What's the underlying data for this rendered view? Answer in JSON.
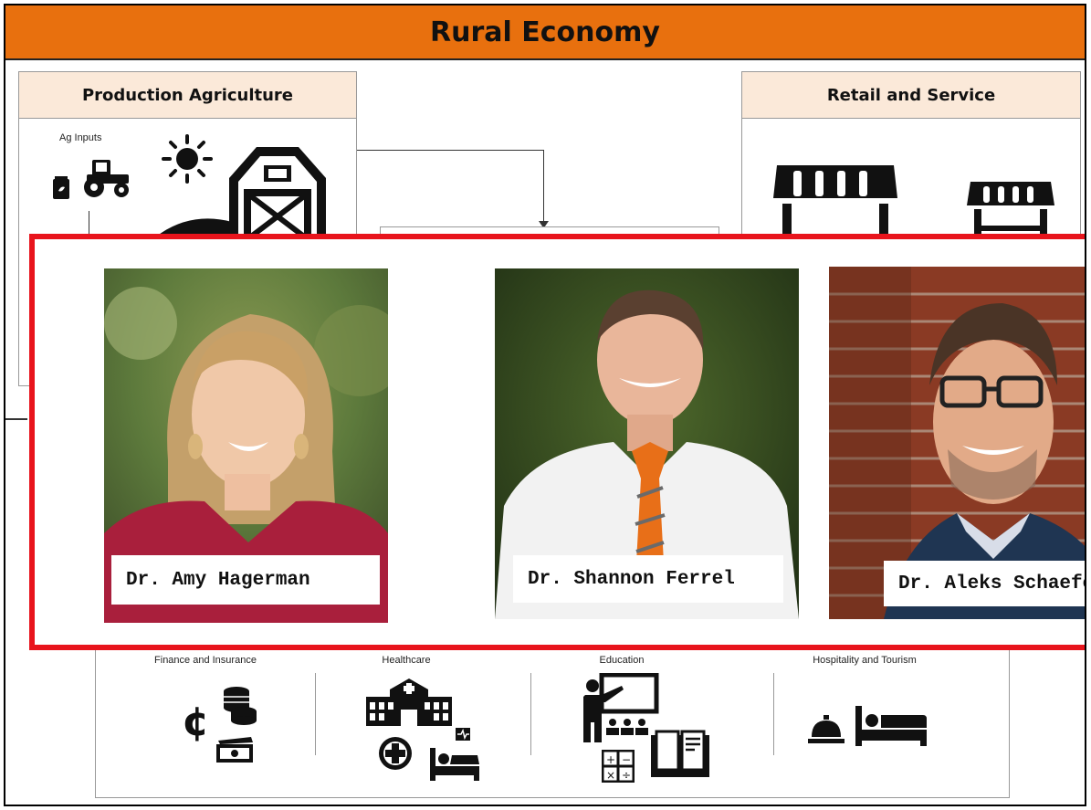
{
  "header": {
    "title": "Rural Economy"
  },
  "production": {
    "title": "Production Agriculture",
    "ag_inputs_label": "Ag Inputs"
  },
  "retail": {
    "title": "Retail and Service"
  },
  "sectors": [
    {
      "label": "Finance and Insurance"
    },
    {
      "label": "Healthcare"
    },
    {
      "label": "Education"
    },
    {
      "label": "Hospitality and Tourism"
    }
  ],
  "people": [
    {
      "name": "Dr. Amy Hagerman"
    },
    {
      "name": "Dr. Shannon Ferrel"
    },
    {
      "name": "Dr. Aleks Schaefer"
    }
  ],
  "colors": {
    "header_orange": "#e8700e",
    "highlight_red": "#e8141c",
    "box_head_fill": "#fbe9d9"
  }
}
